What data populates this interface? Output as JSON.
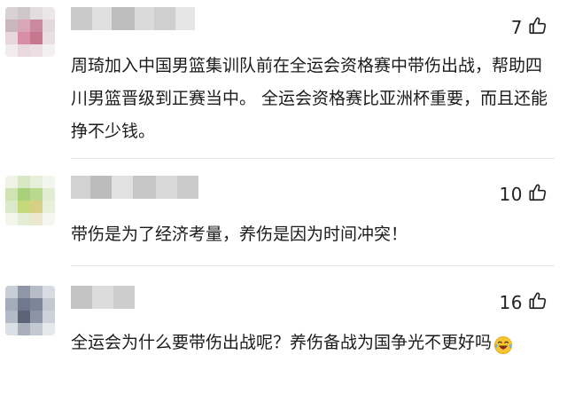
{
  "comments": [
    {
      "likes": "7",
      "text": "周琦加入中国男篮集训队前在全运会资格赛中带伤出战，帮助四川男篮晋级到正赛当中。 全运会资格赛比亚洲杯重要，而且还能挣不少钱。"
    },
    {
      "likes": "10",
      "text": "带伤是为了经济考量，养伤是因为时间冲突！"
    },
    {
      "likes": "16",
      "text": "全运会为什么要带伤出战呢？养伤备战为国争光不更好吗",
      "emoji": "laughing-tears-emoji"
    }
  ],
  "colors": {
    "background": "#ffffff",
    "text": "#1b1b1b",
    "divider": "#e6e6e6",
    "icon_stroke": "#222222"
  },
  "icons": {
    "like": "thumbs-up-icon"
  }
}
